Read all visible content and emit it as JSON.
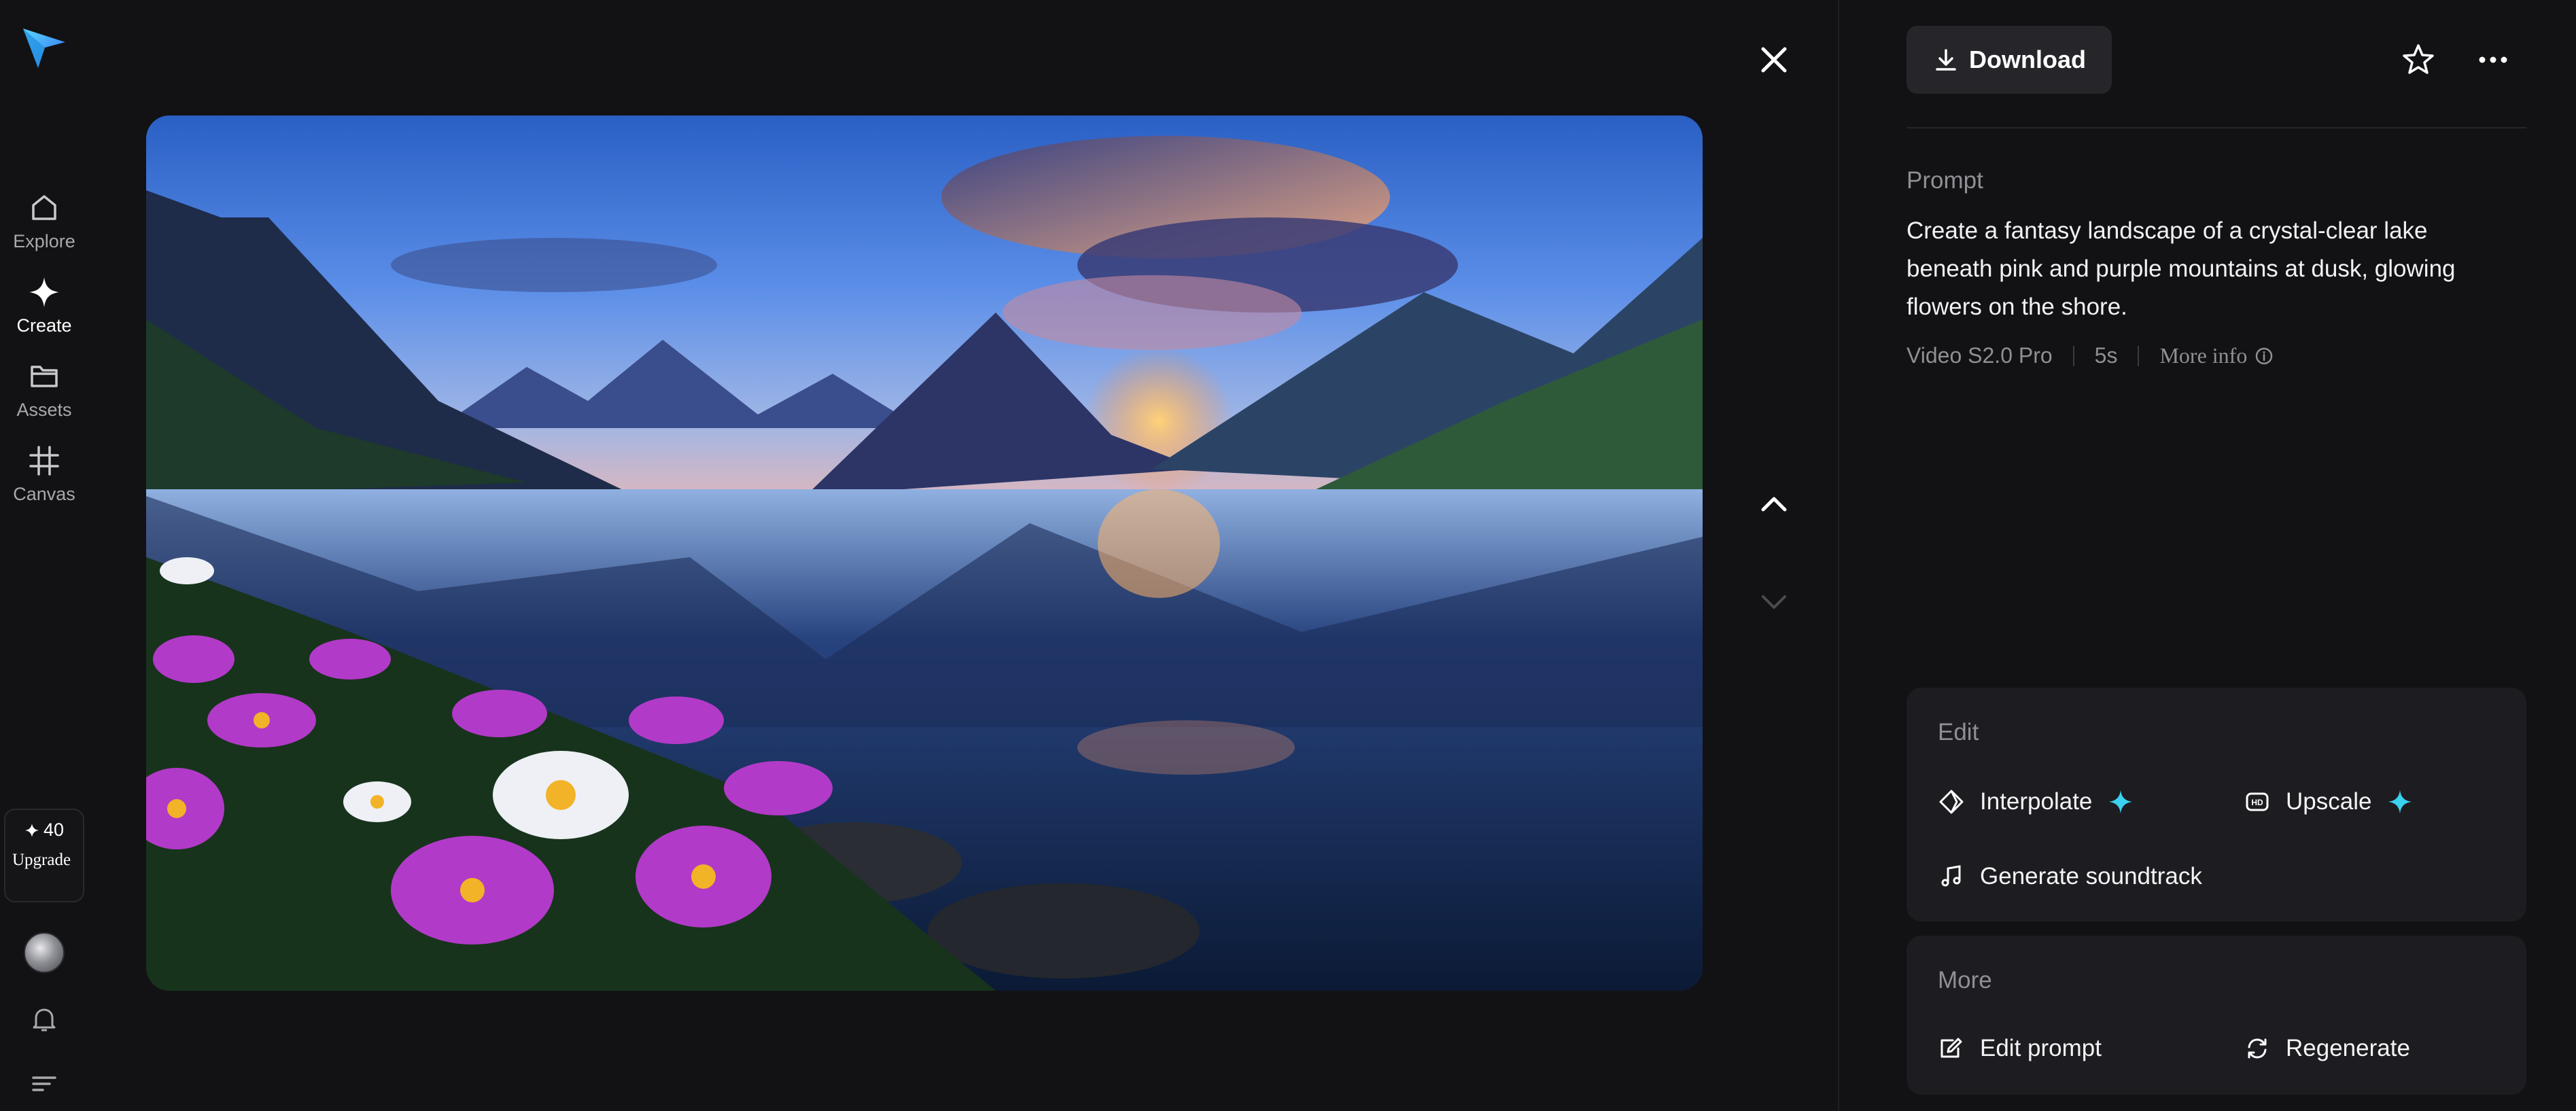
{
  "nav": {
    "items": [
      {
        "label": "Explore",
        "icon": "home-icon"
      },
      {
        "label": "Create",
        "icon": "sparkle-icon"
      },
      {
        "label": "Assets",
        "icon": "folder-icon"
      },
      {
        "label": "Canvas",
        "icon": "crop-icon"
      }
    ],
    "credits": "40",
    "upgrade_label": "Upgrade"
  },
  "toolbar": {
    "download_label": "Download"
  },
  "details": {
    "prompt_label": "Prompt",
    "prompt_text": "Create a fantasy landscape of a crystal-clear lake beneath pink and purple mountains at dusk, glowing flowers on the shore.",
    "model": "Video S2.0 Pro",
    "duration": "5s",
    "more_info_label": "More info"
  },
  "edit": {
    "title": "Edit",
    "interpolate_label": "Interpolate",
    "upscale_label": "Upscale",
    "soundtrack_label": "Generate soundtrack"
  },
  "more": {
    "title": "More",
    "edit_prompt_label": "Edit prompt",
    "regenerate_label": "Regenerate"
  },
  "colors": {
    "background": "#121214",
    "panel": "#1d1d21",
    "accent": "#3ad2f0"
  }
}
